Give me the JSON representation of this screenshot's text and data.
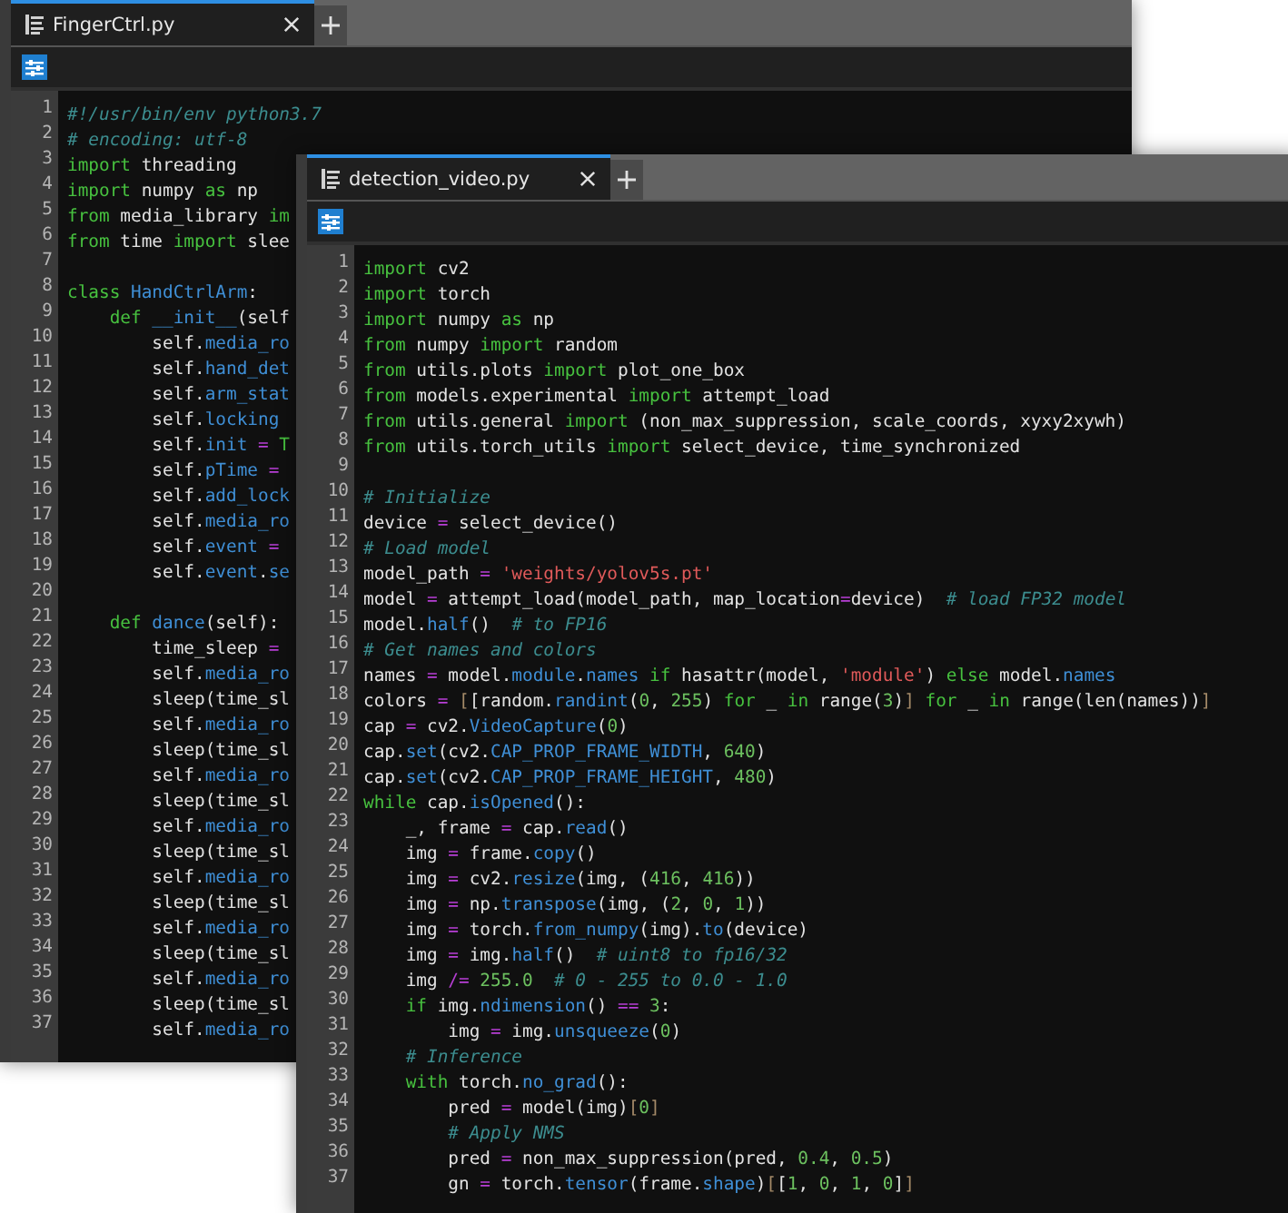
{
  "windows": [
    {
      "tab": {
        "title": "FingerCtrl.py",
        "selected": true
      },
      "lines": [
        {
          "number": "1",
          "tokens": [
            {
              "text": "#!/usr/bin/env python3.7",
              "kind": "comment"
            }
          ]
        },
        {
          "number": "2",
          "tokens": [
            {
              "text": "# encoding: utf-8",
              "kind": "comment"
            }
          ]
        },
        {
          "number": "3",
          "tokens": [
            {
              "text": "import",
              "kind": "keyword"
            },
            {
              "text": " threading",
              "kind": "plain"
            }
          ]
        },
        {
          "number": "4",
          "tokens": [
            {
              "text": "import",
              "kind": "keyword"
            },
            {
              "text": " numpy ",
              "kind": "plain"
            },
            {
              "text": "as",
              "kind": "keyword"
            },
            {
              "text": " np",
              "kind": "plain"
            }
          ]
        },
        {
          "number": "5",
          "tokens": [
            {
              "text": "from",
              "kind": "keyword"
            },
            {
              "text": " media_library ",
              "kind": "plain"
            },
            {
              "text": "im",
              "kind": "keyword"
            }
          ]
        },
        {
          "number": "6",
          "tokens": [
            {
              "text": "from",
              "kind": "keyword"
            },
            {
              "text": " time ",
              "kind": "plain"
            },
            {
              "text": "import",
              "kind": "keyword"
            },
            {
              "text": " slee",
              "kind": "plain"
            }
          ]
        },
        {
          "number": "7"
        },
        {
          "number": "8",
          "tokens": [
            {
              "text": "class",
              "kind": "keyword"
            },
            {
              "text": " HandCtrlArm",
              "kind": "name"
            },
            {
              "text": ":",
              "kind": "plain"
            }
          ]
        },
        {
          "number": "9",
          "tokens": [
            {
              "text": "    def",
              "kind": "keyword"
            },
            {
              "text": " __init__",
              "kind": "name"
            },
            {
              "text": "(self",
              "kind": "plain"
            }
          ]
        },
        {
          "number": "10",
          "tokens": [
            {
              "text": "        self.",
              "kind": "plain"
            },
            {
              "text": "media_ro",
              "kind": "name"
            }
          ]
        },
        {
          "number": "11",
          "tokens": [
            {
              "text": "        self.",
              "kind": "plain"
            },
            {
              "text": "hand_det",
              "kind": "name"
            }
          ]
        },
        {
          "number": "12",
          "tokens": [
            {
              "text": "        self.",
              "kind": "plain"
            },
            {
              "text": "arm_stat",
              "kind": "name"
            }
          ]
        },
        {
          "number": "13",
          "tokens": [
            {
              "text": "        self.",
              "kind": "plain"
            },
            {
              "text": "locking",
              "kind": "name"
            }
          ]
        },
        {
          "number": "14",
          "tokens": [
            {
              "text": "        self.",
              "kind": "plain"
            },
            {
              "text": "init",
              "kind": "name"
            },
            {
              "text": " =",
              "kind": "operator"
            },
            {
              "text": " T",
              "kind": "keyword"
            }
          ]
        },
        {
          "number": "15",
          "tokens": [
            {
              "text": "        self.",
              "kind": "plain"
            },
            {
              "text": "pTime",
              "kind": "name"
            },
            {
              "text": " =",
              "kind": "operator"
            }
          ]
        },
        {
          "number": "16",
          "tokens": [
            {
              "text": "        self.",
              "kind": "plain"
            },
            {
              "text": "add_lock",
              "kind": "name"
            }
          ]
        },
        {
          "number": "17",
          "tokens": [
            {
              "text": "        self.",
              "kind": "plain"
            },
            {
              "text": "media_ro",
              "kind": "name"
            }
          ]
        },
        {
          "number": "18",
          "tokens": [
            {
              "text": "        self.",
              "kind": "plain"
            },
            {
              "text": "event",
              "kind": "name"
            },
            {
              "text": " =",
              "kind": "operator"
            }
          ]
        },
        {
          "number": "19",
          "tokens": [
            {
              "text": "        self.",
              "kind": "plain"
            },
            {
              "text": "event",
              "kind": "name"
            },
            {
              "text": ".",
              "kind": "plain"
            },
            {
              "text": "se",
              "kind": "name"
            }
          ]
        },
        {
          "number": "20"
        },
        {
          "number": "21",
          "tokens": [
            {
              "text": "    def",
              "kind": "keyword"
            },
            {
              "text": " dance",
              "kind": "name"
            },
            {
              "text": "(self):",
              "kind": "plain"
            }
          ]
        },
        {
          "number": "22",
          "tokens": [
            {
              "text": "        time_sleep ",
              "kind": "plain"
            },
            {
              "text": "=",
              "kind": "operator"
            }
          ]
        },
        {
          "number": "23",
          "tokens": [
            {
              "text": "        self.",
              "kind": "plain"
            },
            {
              "text": "media_ro",
              "kind": "name"
            }
          ]
        },
        {
          "number": "24",
          "tokens": [
            {
              "text": "        sleep(time_sl",
              "kind": "plain"
            }
          ]
        },
        {
          "number": "25",
          "tokens": [
            {
              "text": "        self.",
              "kind": "plain"
            },
            {
              "text": "media_ro",
              "kind": "name"
            }
          ]
        },
        {
          "number": "26",
          "tokens": [
            {
              "text": "        sleep(time_sl",
              "kind": "plain"
            }
          ]
        },
        {
          "number": "27",
          "tokens": [
            {
              "text": "        self.",
              "kind": "plain"
            },
            {
              "text": "media_ro",
              "kind": "name"
            }
          ]
        },
        {
          "number": "28",
          "tokens": [
            {
              "text": "        sleep(time_sl",
              "kind": "plain"
            }
          ]
        },
        {
          "number": "29",
          "tokens": [
            {
              "text": "        self.",
              "kind": "plain"
            },
            {
              "text": "media_ro",
              "kind": "name"
            }
          ]
        },
        {
          "number": "30",
          "tokens": [
            {
              "text": "        sleep(time_sl",
              "kind": "plain"
            }
          ]
        },
        {
          "number": "31",
          "tokens": [
            {
              "text": "        self.",
              "kind": "plain"
            },
            {
              "text": "media_ro",
              "kind": "name"
            }
          ]
        },
        {
          "number": "32",
          "tokens": [
            {
              "text": "        sleep(time_sl",
              "kind": "plain"
            }
          ]
        },
        {
          "number": "33",
          "tokens": [
            {
              "text": "        self.",
              "kind": "plain"
            },
            {
              "text": "media_ro",
              "kind": "name"
            }
          ]
        },
        {
          "number": "34",
          "tokens": [
            {
              "text": "        sleep(time_sl",
              "kind": "plain"
            }
          ]
        },
        {
          "number": "35",
          "tokens": [
            {
              "text": "        self.",
              "kind": "plain"
            },
            {
              "text": "media_ro",
              "kind": "name"
            }
          ]
        },
        {
          "number": "36",
          "tokens": [
            {
              "text": "        sleep(time_sl",
              "kind": "plain"
            }
          ]
        },
        {
          "number": "37",
          "tokens": [
            {
              "text": "        self.",
              "kind": "plain"
            },
            {
              "text": "media_ro",
              "kind": "name"
            }
          ]
        }
      ]
    },
    {
      "tab": {
        "title": "detection_video.py",
        "selected": true
      },
      "lines": [
        {
          "number": "1",
          "tokens": [
            {
              "text": "import",
              "kind": "keyword"
            },
            {
              "text": " cv2",
              "kind": "plain"
            }
          ]
        },
        {
          "number": "2",
          "tokens": [
            {
              "text": "import",
              "kind": "keyword"
            },
            {
              "text": " torch",
              "kind": "plain"
            }
          ]
        },
        {
          "number": "3",
          "tokens": [
            {
              "text": "import",
              "kind": "keyword"
            },
            {
              "text": " numpy ",
              "kind": "plain"
            },
            {
              "text": "as",
              "kind": "keyword"
            },
            {
              "text": " np",
              "kind": "plain"
            }
          ]
        },
        {
          "number": "4",
          "tokens": [
            {
              "text": "from",
              "kind": "keyword"
            },
            {
              "text": " numpy ",
              "kind": "plain"
            },
            {
              "text": "import",
              "kind": "keyword"
            },
            {
              "text": " random",
              "kind": "plain"
            }
          ]
        },
        {
          "number": "5",
          "tokens": [
            {
              "text": "from",
              "kind": "keyword"
            },
            {
              "text": " utils.plots ",
              "kind": "plain"
            },
            {
              "text": "import",
              "kind": "keyword"
            },
            {
              "text": " plot_one_box",
              "kind": "plain"
            }
          ]
        },
        {
          "number": "6",
          "tokens": [
            {
              "text": "from",
              "kind": "keyword"
            },
            {
              "text": " models.experimental ",
              "kind": "plain"
            },
            {
              "text": "import",
              "kind": "keyword"
            },
            {
              "text": " attempt_load",
              "kind": "plain"
            }
          ]
        },
        {
          "number": "7",
          "tokens": [
            {
              "text": "from",
              "kind": "keyword"
            },
            {
              "text": " utils.general ",
              "kind": "plain"
            },
            {
              "text": "import",
              "kind": "keyword"
            },
            {
              "text": " (non_max_suppression, scale_coords, xyxy2xywh)",
              "kind": "plain"
            }
          ]
        },
        {
          "number": "8",
          "tokens": [
            {
              "text": "from",
              "kind": "keyword"
            },
            {
              "text": " utils.torch_utils ",
              "kind": "plain"
            },
            {
              "text": "import",
              "kind": "keyword"
            },
            {
              "text": " select_device, time_synchronized",
              "kind": "plain"
            }
          ]
        },
        {
          "number": "9"
        },
        {
          "number": "10",
          "tokens": [
            {
              "text": "# Initialize",
              "kind": "comment"
            }
          ]
        },
        {
          "number": "11",
          "tokens": [
            {
              "text": "device ",
              "kind": "plain"
            },
            {
              "text": "=",
              "kind": "operator"
            },
            {
              "text": " select_device()",
              "kind": "plain"
            }
          ]
        },
        {
          "number": "12",
          "tokens": [
            {
              "text": "# Load model",
              "kind": "comment"
            }
          ]
        },
        {
          "number": "13",
          "tokens": [
            {
              "text": "model_path ",
              "kind": "plain"
            },
            {
              "text": "=",
              "kind": "operator"
            },
            {
              "text": " 'weights/yolov5s.pt'",
              "kind": "string"
            }
          ]
        },
        {
          "number": "14",
          "tokens": [
            {
              "text": "model ",
              "kind": "plain"
            },
            {
              "text": "=",
              "kind": "operator"
            },
            {
              "text": " attempt_load(model_path, map_location",
              "kind": "plain"
            },
            {
              "text": "=",
              "kind": "operator"
            },
            {
              "text": "device)  ",
              "kind": "plain"
            },
            {
              "text": "# load FP32 model",
              "kind": "comment"
            }
          ]
        },
        {
          "number": "15",
          "tokens": [
            {
              "text": "model.",
              "kind": "plain"
            },
            {
              "text": "half",
              "kind": "name"
            },
            {
              "text": "()  ",
              "kind": "plain"
            },
            {
              "text": "# to FP16",
              "kind": "comment"
            }
          ]
        },
        {
          "number": "16",
          "tokens": [
            {
              "text": "# Get names and colors",
              "kind": "comment"
            }
          ]
        },
        {
          "number": "17",
          "tokens": [
            {
              "text": "names ",
              "kind": "plain"
            },
            {
              "text": "=",
              "kind": "operator"
            },
            {
              "text": " model.",
              "kind": "plain"
            },
            {
              "text": "module",
              "kind": "name"
            },
            {
              "text": ".",
              "kind": "plain"
            },
            {
              "text": "names",
              "kind": "name"
            },
            {
              "text": " if",
              "kind": "keyword"
            },
            {
              "text": " hasattr(model, ",
              "kind": "plain"
            },
            {
              "text": "'module'",
              "kind": "string"
            },
            {
              "text": ") ",
              "kind": "plain"
            },
            {
              "text": "else",
              "kind": "keyword"
            },
            {
              "text": " model.",
              "kind": "plain"
            },
            {
              "text": "names",
              "kind": "name"
            }
          ]
        },
        {
          "number": "18",
          "tokens": [
            {
              "text": "colors ",
              "kind": "plain"
            },
            {
              "text": "=",
              "kind": "operator"
            },
            {
              "text": " [",
              "kind": "bracket"
            },
            {
              "text": "[random.",
              "kind": "plain"
            },
            {
              "text": "randint",
              "kind": "name"
            },
            {
              "text": "(",
              "kind": "plain"
            },
            {
              "text": "0",
              "kind": "number"
            },
            {
              "text": ", ",
              "kind": "plain"
            },
            {
              "text": "255",
              "kind": "number"
            },
            {
              "text": ") ",
              "kind": "plain"
            },
            {
              "text": "for",
              "kind": "keyword"
            },
            {
              "text": " _ ",
              "kind": "plain"
            },
            {
              "text": "in",
              "kind": "keyword"
            },
            {
              "text": " range(",
              "kind": "plain"
            },
            {
              "text": "3",
              "kind": "number"
            },
            {
              "text": ")",
              "kind": "plain"
            },
            {
              "text": "]",
              "kind": "bracket"
            },
            {
              "text": " for",
              "kind": "keyword"
            },
            {
              "text": " _ ",
              "kind": "plain"
            },
            {
              "text": "in",
              "kind": "keyword"
            },
            {
              "text": " range(len(names))",
              "kind": "plain"
            },
            {
              "text": "]",
              "kind": "bracket"
            }
          ]
        },
        {
          "number": "19",
          "tokens": [
            {
              "text": "cap ",
              "kind": "plain"
            },
            {
              "text": "=",
              "kind": "operator"
            },
            {
              "text": " cv2.",
              "kind": "plain"
            },
            {
              "text": "VideoCapture",
              "kind": "name"
            },
            {
              "text": "(",
              "kind": "plain"
            },
            {
              "text": "0",
              "kind": "number"
            },
            {
              "text": ")",
              "kind": "plain"
            }
          ]
        },
        {
          "number": "20",
          "tokens": [
            {
              "text": "cap.",
              "kind": "plain"
            },
            {
              "text": "set",
              "kind": "name"
            },
            {
              "text": "(cv2.",
              "kind": "plain"
            },
            {
              "text": "CAP_PROP_FRAME_WIDTH",
              "kind": "name"
            },
            {
              "text": ", ",
              "kind": "plain"
            },
            {
              "text": "640",
              "kind": "number"
            },
            {
              "text": ")",
              "kind": "plain"
            }
          ]
        },
        {
          "number": "21",
          "tokens": [
            {
              "text": "cap.",
              "kind": "plain"
            },
            {
              "text": "set",
              "kind": "name"
            },
            {
              "text": "(cv2.",
              "kind": "plain"
            },
            {
              "text": "CAP_PROP_FRAME_HEIGHT",
              "kind": "name"
            },
            {
              "text": ", ",
              "kind": "plain"
            },
            {
              "text": "480",
              "kind": "number"
            },
            {
              "text": ")",
              "kind": "plain"
            }
          ]
        },
        {
          "number": "22",
          "tokens": [
            {
              "text": "while",
              "kind": "keyword"
            },
            {
              "text": " cap.",
              "kind": "plain"
            },
            {
              "text": "isOpened",
              "kind": "name"
            },
            {
              "text": "():",
              "kind": "plain"
            }
          ]
        },
        {
          "number": "23",
          "tokens": [
            {
              "text": "    _, frame ",
              "kind": "plain"
            },
            {
              "text": "=",
              "kind": "operator"
            },
            {
              "text": " cap.",
              "kind": "plain"
            },
            {
              "text": "read",
              "kind": "name"
            },
            {
              "text": "()",
              "kind": "plain"
            }
          ]
        },
        {
          "number": "24",
          "tokens": [
            {
              "text": "    img ",
              "kind": "plain"
            },
            {
              "text": "=",
              "kind": "operator"
            },
            {
              "text": " frame.",
              "kind": "plain"
            },
            {
              "text": "copy",
              "kind": "name"
            },
            {
              "text": "()",
              "kind": "plain"
            }
          ]
        },
        {
          "number": "25",
          "tokens": [
            {
              "text": "    img ",
              "kind": "plain"
            },
            {
              "text": "=",
              "kind": "operator"
            },
            {
              "text": " cv2.",
              "kind": "plain"
            },
            {
              "text": "resize",
              "kind": "name"
            },
            {
              "text": "(img, (",
              "kind": "plain"
            },
            {
              "text": "416",
              "kind": "number"
            },
            {
              "text": ", ",
              "kind": "plain"
            },
            {
              "text": "416",
              "kind": "number"
            },
            {
              "text": "))",
              "kind": "plain"
            }
          ]
        },
        {
          "number": "26",
          "tokens": [
            {
              "text": "    img ",
              "kind": "plain"
            },
            {
              "text": "=",
              "kind": "operator"
            },
            {
              "text": " np.",
              "kind": "plain"
            },
            {
              "text": "transpose",
              "kind": "name"
            },
            {
              "text": "(img, (",
              "kind": "plain"
            },
            {
              "text": "2",
              "kind": "number"
            },
            {
              "text": ", ",
              "kind": "plain"
            },
            {
              "text": "0",
              "kind": "number"
            },
            {
              "text": ", ",
              "kind": "plain"
            },
            {
              "text": "1",
              "kind": "number"
            },
            {
              "text": "))",
              "kind": "plain"
            }
          ]
        },
        {
          "number": "27",
          "tokens": [
            {
              "text": "    img ",
              "kind": "plain"
            },
            {
              "text": "=",
              "kind": "operator"
            },
            {
              "text": " torch.",
              "kind": "plain"
            },
            {
              "text": "from_numpy",
              "kind": "name"
            },
            {
              "text": "(img).",
              "kind": "plain"
            },
            {
              "text": "to",
              "kind": "name"
            },
            {
              "text": "(device)",
              "kind": "plain"
            }
          ]
        },
        {
          "number": "28",
          "tokens": [
            {
              "text": "    img ",
              "kind": "plain"
            },
            {
              "text": "=",
              "kind": "operator"
            },
            {
              "text": " img.",
              "kind": "plain"
            },
            {
              "text": "half",
              "kind": "name"
            },
            {
              "text": "()  ",
              "kind": "plain"
            },
            {
              "text": "# uint8 to fp16/32",
              "kind": "comment"
            }
          ]
        },
        {
          "number": "29",
          "tokens": [
            {
              "text": "    img ",
              "kind": "plain"
            },
            {
              "text": "/=",
              "kind": "operator"
            },
            {
              "text": " 255.0",
              "kind": "number"
            },
            {
              "text": "  # 0 - 255 to 0.0 - 1.0",
              "kind": "comment"
            }
          ]
        },
        {
          "number": "30",
          "tokens": [
            {
              "text": "    if",
              "kind": "keyword"
            },
            {
              "text": " img.",
              "kind": "plain"
            },
            {
              "text": "ndimension",
              "kind": "name"
            },
            {
              "text": "() ",
              "kind": "plain"
            },
            {
              "text": "==",
              "kind": "operator"
            },
            {
              "text": " 3",
              "kind": "number"
            },
            {
              "text": ":",
              "kind": "plain"
            }
          ]
        },
        {
          "number": "31",
          "tokens": [
            {
              "text": "        img ",
              "kind": "plain"
            },
            {
              "text": "=",
              "kind": "operator"
            },
            {
              "text": " img.",
              "kind": "plain"
            },
            {
              "text": "unsqueeze",
              "kind": "name"
            },
            {
              "text": "(",
              "kind": "plain"
            },
            {
              "text": "0",
              "kind": "number"
            },
            {
              "text": ")",
              "kind": "plain"
            }
          ]
        },
        {
          "number": "32",
          "tokens": [
            {
              "text": "    # Inference",
              "kind": "comment"
            }
          ]
        },
        {
          "number": "33",
          "tokens": [
            {
              "text": "    with",
              "kind": "keyword"
            },
            {
              "text": " torch.",
              "kind": "plain"
            },
            {
              "text": "no_grad",
              "kind": "name"
            },
            {
              "text": "():",
              "kind": "plain"
            }
          ]
        },
        {
          "number": "34",
          "tokens": [
            {
              "text": "        pred ",
              "kind": "plain"
            },
            {
              "text": "=",
              "kind": "operator"
            },
            {
              "text": " model(img)",
              "kind": "plain"
            },
            {
              "text": "[",
              "kind": "bracket"
            },
            {
              "text": "0",
              "kind": "number"
            },
            {
              "text": "]",
              "kind": "bracket"
            }
          ]
        },
        {
          "number": "35",
          "tokens": [
            {
              "text": "        # Apply NMS",
              "kind": "comment"
            }
          ]
        },
        {
          "number": "36",
          "tokens": [
            {
              "text": "        pred ",
              "kind": "plain"
            },
            {
              "text": "=",
              "kind": "operator"
            },
            {
              "text": " non_max_suppression(pred, ",
              "kind": "plain"
            },
            {
              "text": "0.4",
              "kind": "number"
            },
            {
              "text": ", ",
              "kind": "plain"
            },
            {
              "text": "0.5",
              "kind": "number"
            },
            {
              "text": ")",
              "kind": "plain"
            }
          ]
        },
        {
          "number": "37",
          "tokens": [
            {
              "text": "        gn ",
              "kind": "plain"
            },
            {
              "text": "=",
              "kind": "operator"
            },
            {
              "text": " torch.",
              "kind": "plain"
            },
            {
              "text": "tensor",
              "kind": "name"
            },
            {
              "text": "(frame.",
              "kind": "plain"
            },
            {
              "text": "shape",
              "kind": "name"
            },
            {
              "text": ")",
              "kind": "plain"
            },
            {
              "text": "[",
              "kind": "bracket"
            },
            {
              "text": "[",
              "kind": "plain"
            },
            {
              "text": "1",
              "kind": "number"
            },
            {
              "text": ", ",
              "kind": "plain"
            },
            {
              "text": "0",
              "kind": "number"
            },
            {
              "text": ", ",
              "kind": "plain"
            },
            {
              "text": "1",
              "kind": "number"
            },
            {
              "text": ", ",
              "kind": "plain"
            },
            {
              "text": "0",
              "kind": "number"
            },
            {
              "text": "]",
              "kind": "plain"
            },
            {
              "text": "]",
              "kind": "bracket"
            }
          ]
        }
      ]
    }
  ]
}
